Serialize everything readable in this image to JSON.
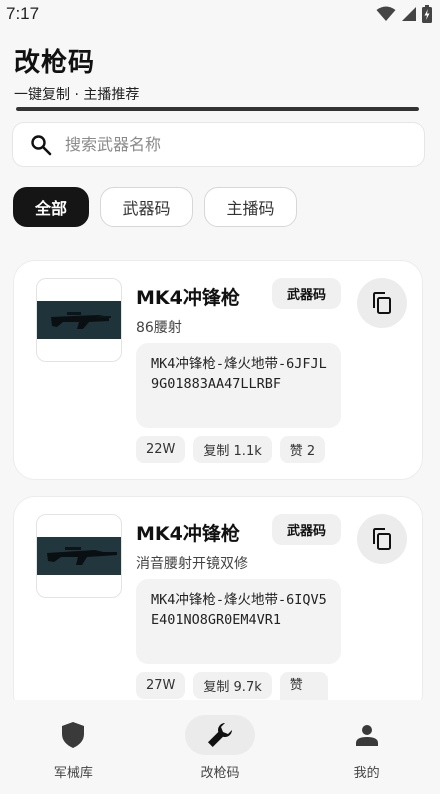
{
  "status_bar": {
    "time": "7:17"
  },
  "header": {
    "title": "改枪码",
    "subtitle": "一键复制 · 主播推荐",
    "progress": 1.0
  },
  "search": {
    "placeholder": "搜索武器名称",
    "value": ""
  },
  "filters": [
    {
      "label": "全部",
      "active": true
    },
    {
      "label": "武器码",
      "active": false
    },
    {
      "label": "主播码",
      "active": false
    }
  ],
  "cards": [
    {
      "name": "MK4冲锋枪",
      "badge": "武器码",
      "description": "86腰射",
      "code": "MK4冲锋枪-烽火地带-6JFJL9G01883AA47LLRBF",
      "stats": {
        "views": "22W",
        "copies": "复制 1.1k",
        "likes": "赞 2"
      }
    },
    {
      "name": "MK4冲锋枪",
      "badge": "武器码",
      "description": "消音腰射开镜双修",
      "code": "MK4冲锋枪-烽火地带-6IQV5E401NO8GR0EM4VR1",
      "stats": {
        "views": "27W",
        "copies": "复制 9.7k",
        "likes": "赞"
      }
    }
  ],
  "bottom_nav": [
    {
      "label": "军械库",
      "icon": "shield-icon",
      "active": false
    },
    {
      "label": "改枪码",
      "icon": "wrench-icon",
      "active": true
    },
    {
      "label": "我的",
      "icon": "person-icon",
      "active": false
    }
  ],
  "colors": {
    "accent": "#151515",
    "background": "#f7f7f7",
    "card": "#ffffff",
    "chip_bg": "#f1f1f1"
  }
}
